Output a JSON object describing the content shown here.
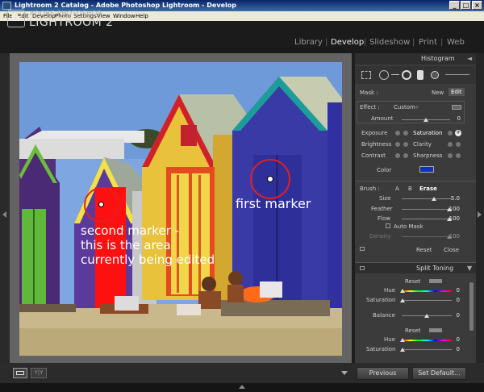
{
  "window": {
    "title": "Lightroom 2 Catalog - Adobe Photoshop Lightroom - Develop",
    "minimize": "_",
    "maximize": "□",
    "close": "×"
  },
  "menu": [
    "File",
    "Edit",
    "Develop",
    "Photo",
    "Settings",
    "View",
    "Window",
    "Help"
  ],
  "brand": {
    "logo": "Lr",
    "top": "ADOBE PHOTOSHOP",
    "main": "LIGHTROOM 2"
  },
  "modules": [
    "Library",
    "Develop",
    "Slideshow",
    "Print",
    "Web"
  ],
  "active_module": "Develop",
  "photo": {
    "annotation_first": "first marker",
    "annotation_second": [
      "second marker -",
      "this is the area",
      "currently being edited"
    ]
  },
  "panel": {
    "histogram_header": "Histogram",
    "mask_label": "Mask :",
    "mask_new": "New",
    "mask_edit": "Edit",
    "effect_label": "Effect :",
    "effect_value": "Custom",
    "amount_label": "Amount",
    "amount_value": "0",
    "left_params": [
      "Exposure",
      "Brightness",
      "Contrast"
    ],
    "right_params": [
      "Saturation",
      "Clarity",
      "Sharpness"
    ],
    "color_label": "Color",
    "color_swatch": "#1030c8",
    "brush_label": "Brush :",
    "brush_a": "A",
    "brush_b": "B",
    "brush_erase": "Erase",
    "size_label": "Size",
    "size_value": "5.0",
    "feather_label": "Feather",
    "feather_value": "100",
    "flow_label": "Flow",
    "flow_value": "100",
    "automask_label": "Auto Mask",
    "density_label": "Density",
    "density_value": "100",
    "reset": "Reset",
    "close": "Close",
    "split_header": "Split Toning",
    "st_reset_1": "Reset",
    "st_hue_1": "Hue",
    "st_hue_1_value": "0",
    "st_sat_1": "Saturation",
    "st_sat_1_value": "0",
    "balance_label": "Balance",
    "balance_value": "0",
    "st_reset_2": "Reset",
    "st_hue_2": "Hue",
    "st_hue_2_value": "0",
    "st_sat_2": "Saturation",
    "st_sat_2_value": "0"
  },
  "bottom": {
    "view_loupe": "",
    "view_compare": "Y|Y",
    "previous": "Previous",
    "set_default": "Set Default..."
  }
}
